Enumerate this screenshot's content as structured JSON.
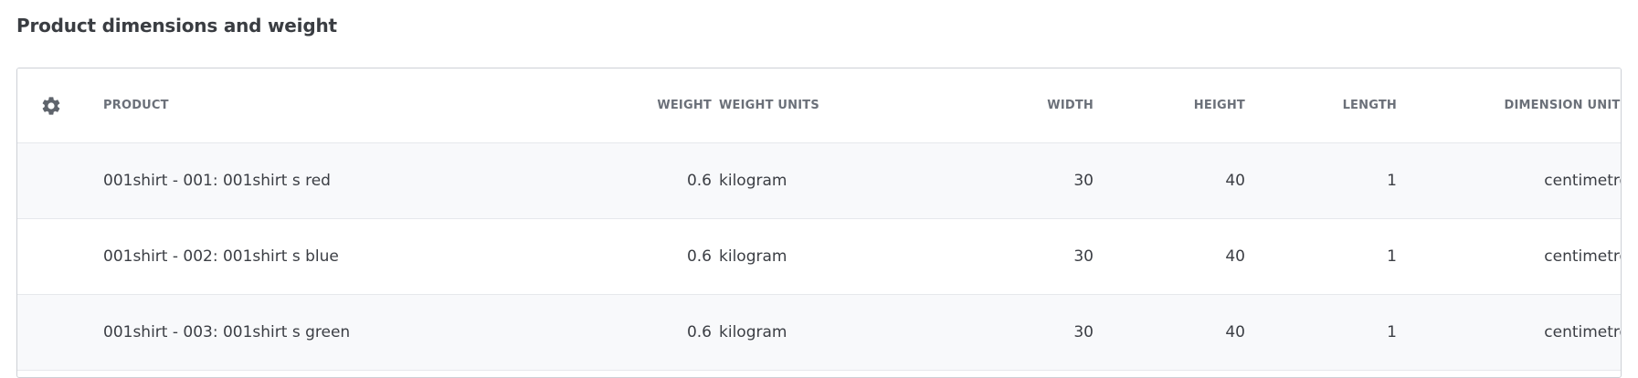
{
  "page": {
    "title": "Product dimensions and weight"
  },
  "table": {
    "settings_icon": "gear-icon",
    "columns": {
      "product": "PRODUCT",
      "weight": "WEIGHT",
      "weight_units": "WEIGHT UNITS",
      "width": "WIDTH",
      "height": "HEIGHT",
      "length": "LENGTH",
      "dimension_units": "DIMENSION UNITS"
    },
    "rows": [
      {
        "product": "001shirt - 001: 001shirt s red",
        "weight": "0.6",
        "weight_units": "kilogram",
        "width": "30",
        "height": "40",
        "length": "1",
        "dimension_units": "centimetre"
      },
      {
        "product": "001shirt - 002: 001shirt s blue",
        "weight": "0.6",
        "weight_units": "kilogram",
        "width": "30",
        "height": "40",
        "length": "1",
        "dimension_units": "centimetre"
      },
      {
        "product": "001shirt - 003: 001shirt s green",
        "weight": "0.6",
        "weight_units": "kilogram",
        "width": "30",
        "height": "40",
        "length": "1",
        "dimension_units": "centimetre"
      }
    ]
  }
}
